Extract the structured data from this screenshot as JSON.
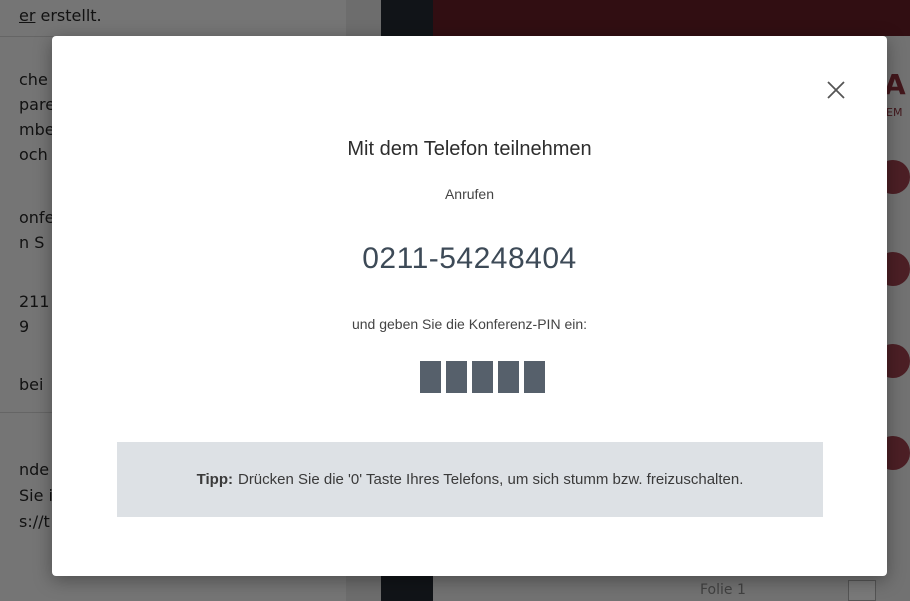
{
  "background": {
    "top_line_prefix": "",
    "top_line_link": "er",
    "top_line_rest": " erstellt.",
    "fragments": [
      "che",
      "pare",
      "mbe",
      "och",
      "onfe",
      "n S",
      "211",
      "9",
      "bei",
      "nde",
      "Sie i",
      "s://t"
    ],
    "brand_letter": "A",
    "brand_sub": "EM",
    "bottom_text": "Folie 1"
  },
  "modal": {
    "title": "Mit dem Telefon teilnehmen",
    "call_label": "Anrufen",
    "phone_number": "0211-54248404",
    "pin_label": "und geben Sie die Konferenz-PIN ein:",
    "pin_digit_count": 5,
    "tip_label": "Tipp:",
    "tip_text": "Drücken Sie die '0' Taste Ihres Telefons, um sich stumm bzw. freizuschalten.",
    "close_icon": "close-icon"
  },
  "colors": {
    "pin_mask": "#56606b",
    "tip_background": "#dde1e5",
    "phone_number": "#3d4a57"
  }
}
